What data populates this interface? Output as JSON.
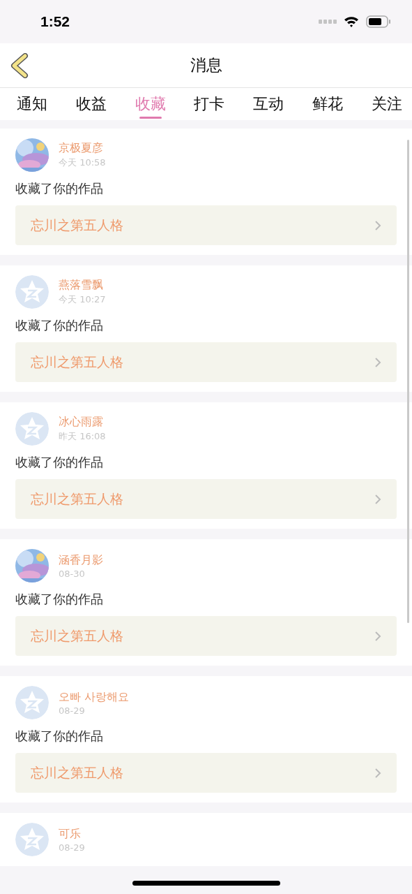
{
  "status_bar": {
    "time": "1:52"
  },
  "nav": {
    "title": "消息"
  },
  "tabs": [
    {
      "label": "通知",
      "selected": false
    },
    {
      "label": "收益",
      "selected": false
    },
    {
      "label": "收藏",
      "selected": true
    },
    {
      "label": "打卡",
      "selected": false
    },
    {
      "label": "互动",
      "selected": false
    },
    {
      "label": "鲜花",
      "selected": false
    },
    {
      "label": "关注",
      "selected": false
    }
  ],
  "messages": [
    {
      "kind": "picture",
      "name": "京极夏彦",
      "time": "今天 10:58",
      "text": "收藏了你的作品",
      "work": "忘川之第五人格"
    },
    {
      "kind": "default",
      "name": "燕落雪飘",
      "time": "今天 10:27",
      "text": "收藏了你的作品",
      "work": "忘川之第五人格"
    },
    {
      "kind": "default",
      "name": "冰心雨露",
      "time": "昨天 16:08",
      "text": "收藏了你的作品",
      "work": "忘川之第五人格"
    },
    {
      "kind": "picture",
      "name": "涵香月影",
      "time": "08-30",
      "text": "收藏了你的作品",
      "work": "忘川之第五人格"
    },
    {
      "kind": "default",
      "name": "오빠 사랑해요",
      "time": "08-29",
      "text": "收藏了你的作品",
      "work": "忘川之第五人格"
    },
    {
      "kind": "default",
      "name": "可乐",
      "time": "08-29"
    }
  ]
}
